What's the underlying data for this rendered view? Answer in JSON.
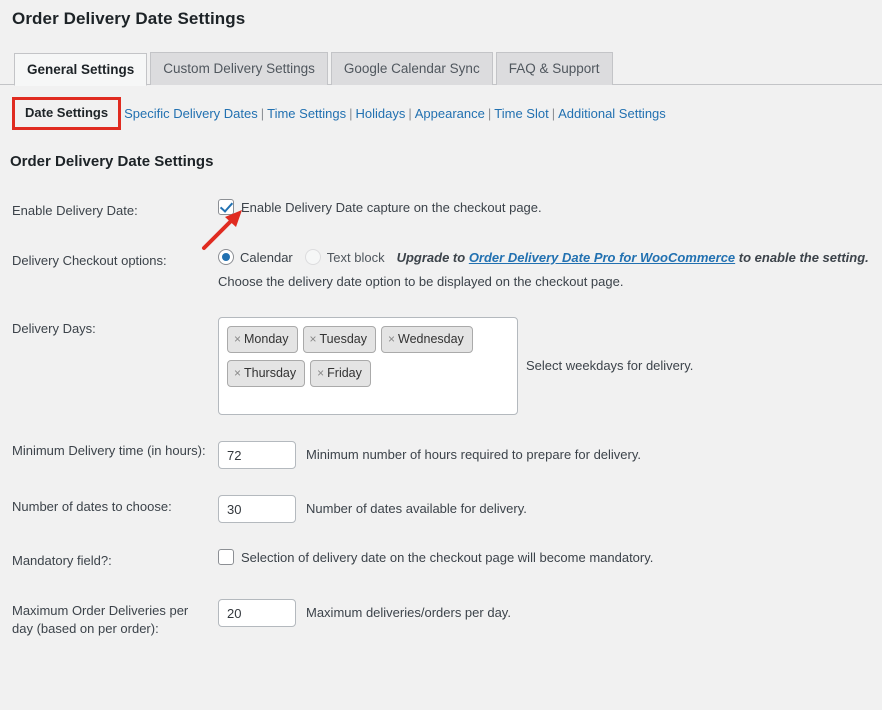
{
  "page": {
    "title": "Order Delivery Date Settings",
    "section_heading": "Order Delivery Date Settings"
  },
  "tabs": [
    {
      "label": "General Settings",
      "active": true
    },
    {
      "label": "Custom Delivery Settings",
      "active": false
    },
    {
      "label": "Google Calendar Sync",
      "active": false
    },
    {
      "label": "FAQ & Support",
      "active": false
    }
  ],
  "subnav": {
    "current": "Date Settings",
    "links": [
      "Specific Delivery Dates",
      "Time Settings",
      "Holidays",
      "Appearance",
      "Time Slot",
      "Additional Settings"
    ],
    "separator": "|"
  },
  "settings": {
    "enable_delivery_date": {
      "label": "Enable Delivery Date:",
      "checkbox_label": "Enable Delivery Date capture on the checkout page.",
      "checked": true
    },
    "checkout_options": {
      "label": "Delivery Checkout options:",
      "option_calendar": "Calendar",
      "option_textblock": "Text block",
      "upgrade_prefix": "Upgrade to ",
      "upgrade_link": "Order Delivery Date Pro for WooCommerce",
      "upgrade_suffix": " to enable the setting.",
      "helper": "Choose the delivery date option to be displayed on the checkout page."
    },
    "delivery_days": {
      "label": "Delivery Days:",
      "chips": [
        "Monday",
        "Tuesday",
        "Wednesday",
        "Thursday",
        "Friday"
      ],
      "remove_icon": "×",
      "helper": "Select weekdays for delivery."
    },
    "minimum_delivery_time": {
      "label": "Minimum Delivery time (in hours):",
      "value": "72",
      "helper": "Minimum number of hours required to prepare for delivery."
    },
    "number_of_dates": {
      "label": "Number of dates to choose:",
      "value": "30",
      "helper": "Number of dates available for delivery."
    },
    "mandatory_field": {
      "label": "Mandatory field?:",
      "checkbox_label": "Selection of delivery date on the checkout page will become mandatory.",
      "checked": false
    },
    "max_deliveries": {
      "label": "Maximum Order Deliveries per day (based on per order):",
      "value": "20",
      "helper": "Maximum deliveries/orders per day."
    }
  },
  "colors": {
    "accent_link": "#2271b1",
    "annotation_red": "#e02b20",
    "background": "#f1f1f1"
  }
}
